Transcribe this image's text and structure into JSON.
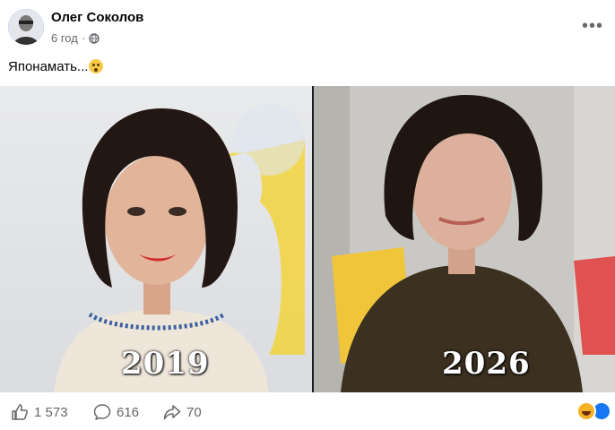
{
  "post": {
    "author": "Олег Соколов",
    "time": "6 год",
    "separator": "·",
    "text": "Японамать...",
    "more_label": "•••"
  },
  "media": {
    "left_year": "2019",
    "right_year": "2026"
  },
  "actions": {
    "likes": "1 573",
    "comments": "616",
    "shares": "70"
  },
  "icons": {
    "privacy": "globe-icon",
    "like": "thumbs-up-icon",
    "comment": "comment-bubble-icon",
    "share": "share-arrow-icon",
    "reactions": [
      "haha-reaction-icon",
      "like-reaction-icon"
    ]
  },
  "colors": {
    "accent": "#1877f2",
    "secondary_text": "#65676b",
    "primary_text": "#050505"
  }
}
